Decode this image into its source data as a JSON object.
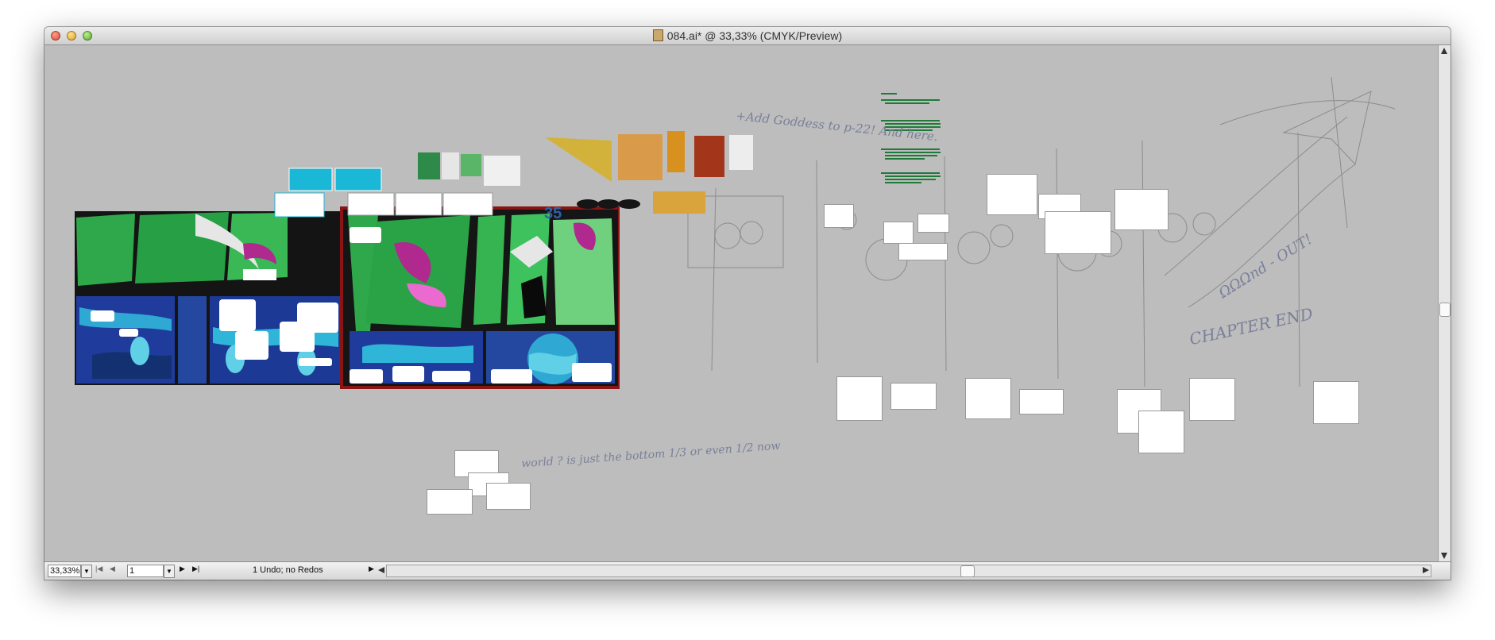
{
  "window": {
    "title": "084.ai* @ 33,33% (CMYK/Preview)",
    "file_icon": "illustrator-file-icon"
  },
  "statusbar": {
    "zoom": "33,33%",
    "page": "1",
    "undo": "1 Undo; no Redos"
  },
  "canvas": {
    "handwriting": {
      "goddess": "+Add Goddess to p-22! And here.",
      "bottom": "world ? is just the bottom 1/3 or even 1/2 now",
      "chapter_end": "CHAPTER END",
      "out": "ΩΩΩnd - OUT!"
    },
    "big_number": "35"
  },
  "colors": {
    "canvas_bg": "#bdbdbd",
    "comic_green": "#2ea84a",
    "comic_blue": "#1f3c9c",
    "comic_magenta": "#b0298f",
    "swatch_cyan": "#1bb7d6"
  }
}
